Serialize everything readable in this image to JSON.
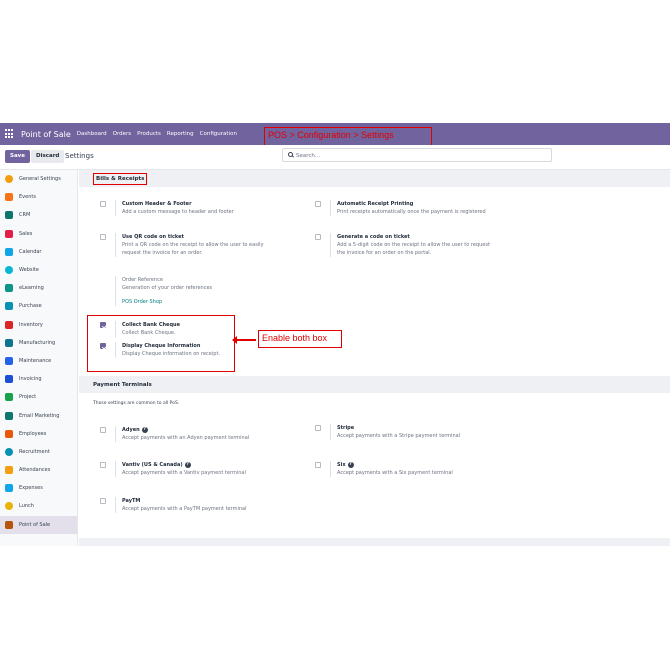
{
  "navbar": {
    "brand": "Point of Sale",
    "menu": [
      "Dashboard",
      "Orders",
      "Products",
      "Reporting",
      "Configuration"
    ],
    "annotation": "POS > Configuration > Settings"
  },
  "controls": {
    "save_label": "Save",
    "discard_label": "Discard",
    "title": "Settings",
    "search_placeholder": "Search..."
  },
  "sidebar": {
    "items": [
      {
        "label": "General Settings",
        "color": "#f59e0b"
      },
      {
        "label": "Events",
        "color": "#f97316"
      },
      {
        "label": "CRM",
        "color": "#0f766e"
      },
      {
        "label": "Sales",
        "color": "#e11d48"
      },
      {
        "label": "Calendar",
        "color": "#0ea5e9"
      },
      {
        "label": "Website",
        "color": "#06b6d4"
      },
      {
        "label": "eLearning",
        "color": "#0d9488"
      },
      {
        "label": "Purchase",
        "color": "#0891b2"
      },
      {
        "label": "Inventory",
        "color": "#dc2626"
      },
      {
        "label": "Manufacturing",
        "color": "#0e7490"
      },
      {
        "label": "Maintenance",
        "color": "#2563eb"
      },
      {
        "label": "Invoicing",
        "color": "#1d4ed8"
      },
      {
        "label": "Project",
        "color": "#16a34a"
      },
      {
        "label": "Email Marketing",
        "color": "#0f766e"
      },
      {
        "label": "Employees",
        "color": "#ea580c"
      },
      {
        "label": "Recruitment",
        "color": "#0891b2"
      },
      {
        "label": "Attendances",
        "color": "#f59e0b"
      },
      {
        "label": "Expenses",
        "color": "#0ea5e9"
      },
      {
        "label": "Lunch",
        "color": "#eab308"
      },
      {
        "label": "Point of Sale",
        "color": "#b45309"
      }
    ],
    "active": "Point of Sale"
  },
  "bills": {
    "heading": "Bills & Receipts",
    "custom_header": {
      "title": "Custom Header & Footer",
      "desc": "Add a custom message to header and footer"
    },
    "auto_print": {
      "title": "Automatic Receipt Printing",
      "desc": "Print receipts automatically once the payment is registered"
    },
    "qr_code": {
      "title": "Use QR code on ticket",
      "desc1": "Print a QR code on the receipt to allow the user to easily",
      "desc2": "request the invoice for an order."
    },
    "gen_code": {
      "title": "Generate a code on ticket",
      "desc1": "Add a 5-digit code on the receipt to allow the user to request",
      "desc2": "the invoice for an order on the portal."
    },
    "order_ref": {
      "title": "Order Reference",
      "desc": "Generation of your order references",
      "link": "POS Order Shop"
    },
    "collect_cheque": {
      "title": "Collect Bank Cheque",
      "desc": "Collect Bank Cheque."
    },
    "display_cheque": {
      "title": "Display Cheque Information",
      "desc": "Display Cheque information on receipt."
    },
    "annotation": "Enable both box"
  },
  "payment": {
    "heading": "Payment Terminals",
    "note": "Those settings are common to all PoS.",
    "adyen": {
      "title": "Adyen",
      "desc": "Accept payments with an Adyen payment terminal"
    },
    "stripe": {
      "title": "Stripe",
      "desc": "Accept payments with a Stripe payment terminal"
    },
    "vantiv": {
      "title": "Vantiv (US & Canada)",
      "desc": "Accept payments with a Vantiv payment terminal"
    },
    "six": {
      "title": "Six",
      "desc": "Accept payments with a Six payment terminal"
    },
    "paytm": {
      "title": "PayTM",
      "desc": "Accept payments with a PayTM payment terminal"
    }
  }
}
